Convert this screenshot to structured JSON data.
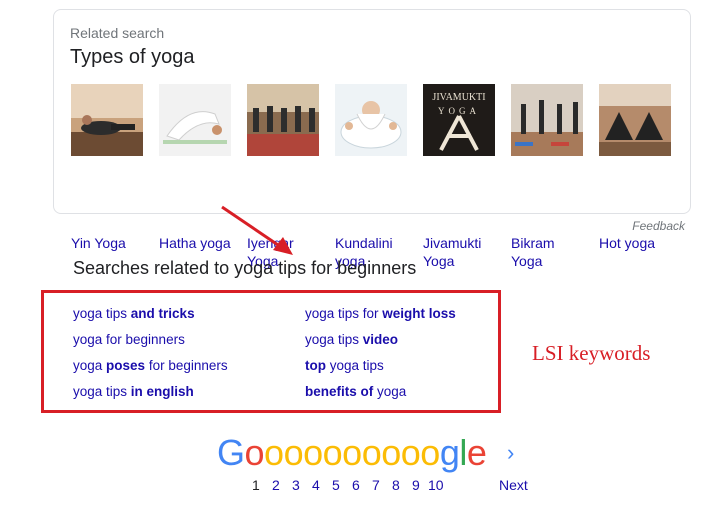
{
  "card": {
    "subtitle": "Related search",
    "title": "Types of yoga",
    "items": [
      {
        "line1": "Yin Yoga",
        "line2": ""
      },
      {
        "line1": "Hatha yoga",
        "line2": ""
      },
      {
        "line1": "Iyengar",
        "line2": "Yoga"
      },
      {
        "line1": "Kundalini",
        "line2": "yoga"
      },
      {
        "line1": "Jivamukti",
        "line2": "Yoga"
      },
      {
        "line1": "Bikram",
        "line2": "Yoga"
      },
      {
        "line1": "Hot yoga",
        "line2": ""
      }
    ],
    "feedback": "Feedback"
  },
  "related": {
    "title": "Searches related to yoga tips for beginners",
    "links": [
      {
        "a": "yoga tips ",
        "b": "and tricks",
        "c": ""
      },
      {
        "a": "yoga tips for ",
        "b": "weight loss",
        "c": ""
      },
      {
        "a": "yoga for beginners",
        "b": "",
        "c": ""
      },
      {
        "a": "yoga tips ",
        "b": "video",
        "c": ""
      },
      {
        "a": "yoga ",
        "b": "poses",
        "c": " for beginners"
      },
      {
        "a": "",
        "b": "top",
        "c": " yoga tips"
      },
      {
        "a": "yoga tips ",
        "b": "in english",
        "c": ""
      },
      {
        "a": "",
        "b": "benefits of",
        "c": " yoga"
      }
    ]
  },
  "annotation": {
    "label": "LSI keywords",
    "color": "#d81f26"
  },
  "pagination": {
    "logo_letters": [
      "G",
      "o",
      "o",
      "o",
      "o",
      "o",
      "o",
      "o",
      "o",
      "o",
      "o",
      "g",
      "l",
      "e"
    ],
    "current": "1",
    "pages": [
      "1",
      "2",
      "3",
      "4",
      "5",
      "6",
      "7",
      "8",
      "9",
      "10"
    ],
    "next_label": "Next",
    "next_icon": "chevron-right-icon"
  },
  "colors": {
    "link": "#1a0dab",
    "text": "#202124",
    "muted": "#70757a",
    "google_blue": "#4285f4",
    "google_red": "#ea4335",
    "google_yellow": "#fbbc05",
    "google_green": "#34a853"
  }
}
